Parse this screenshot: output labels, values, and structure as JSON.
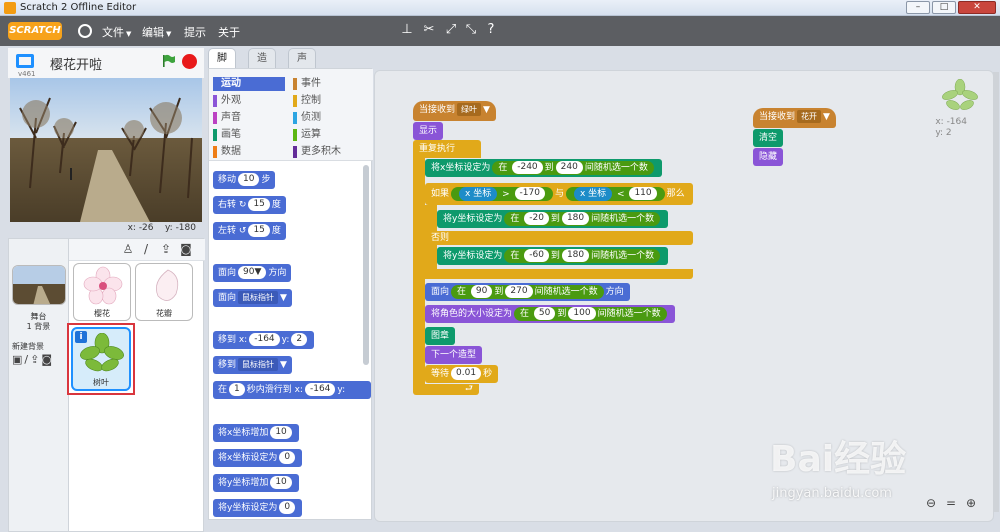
{
  "window": {
    "title": "Scratch 2 Offline Editor"
  },
  "menubar": {
    "logo": "SCRATCH",
    "menus": [
      {
        "label": "文件",
        "arrow": "▼"
      },
      {
        "label": "编辑",
        "arrow": "▼"
      },
      {
        "label": "提示",
        "arrow": ""
      },
      {
        "label": "关于",
        "arrow": ""
      }
    ],
    "tools": [
      "stamp-icon",
      "scissors-icon",
      "grow-icon",
      "shrink-icon",
      "help-icon"
    ]
  },
  "stage": {
    "project_title": "樱花开啦",
    "version": "v461",
    "mouse_x_label": "x:",
    "mouse_x": "-26",
    "mouse_y_label": "y:",
    "mouse_y": "-180"
  },
  "sprites": {
    "backdrop_label": "舞台",
    "backdrop_count": "1 背景",
    "new_backdrop_label": "新建背景",
    "items": [
      {
        "name": "樱花"
      },
      {
        "name": "花瓣"
      },
      {
        "name": "树叶"
      }
    ]
  },
  "tabs": [
    "脚本",
    "造型",
    "声音"
  ],
  "categories": {
    "left": [
      {
        "label": "运动",
        "color": "#4a6cd4",
        "active": true
      },
      {
        "label": "外观",
        "color": "#8a55d7"
      },
      {
        "label": "声音",
        "color": "#bb42c3"
      },
      {
        "label": "画笔",
        "color": "#0e9a6c"
      },
      {
        "label": "数据",
        "color": "#ee7d16"
      }
    ],
    "right": [
      {
        "label": "事件",
        "color": "#c88330"
      },
      {
        "label": "控制",
        "color": "#e1a91a"
      },
      {
        "label": "侦测",
        "color": "#2ca5e2"
      },
      {
        "label": "运算",
        "color": "#5cb712"
      },
      {
        "label": "更多积木",
        "color": "#632d99"
      }
    ]
  },
  "palette": {
    "move": {
      "pre": "移动",
      "val": "10",
      "post": "步"
    },
    "turn_right": {
      "pre": "右转",
      "val": "15",
      "post": "度"
    },
    "turn_left": {
      "pre": "左转",
      "val": "15",
      "post": "度"
    },
    "point_dir": {
      "pre": "面向",
      "val": "90▼",
      "post": "方向"
    },
    "point_towards": {
      "pre": "面向",
      "dd": "鼠标指针"
    },
    "goto_xy": {
      "pre": "移到 x:",
      "x": "-164",
      "mid": "y:",
      "y": "2"
    },
    "goto": {
      "pre": "移到",
      "dd": "鼠标指针"
    },
    "glide": {
      "pre": "在",
      "val": "1",
      "mid": "秒内滑行到 x:",
      "x": "-164",
      "post": "y:"
    },
    "change_x": {
      "pre": "将x坐标增加",
      "val": "10"
    },
    "set_x": {
      "pre": "将x坐标设定为",
      "val": "0"
    },
    "change_y": {
      "pre": "将y坐标增加",
      "val": "10"
    },
    "set_y": {
      "pre": "将y坐标设定为",
      "val": "0"
    }
  },
  "script1": {
    "hat": {
      "pre": "当接收到",
      "dd": "绿叶"
    },
    "show": "显示",
    "forever": "重复执行",
    "setx": {
      "pre": "将x坐标设定为",
      "in": "在",
      "a": "-240",
      "to": "到",
      "b": "240",
      "post": "间随机选一个数"
    },
    "if": {
      "pre": "如果",
      "xpos": "x 坐标",
      "gt": ">",
      "v1": "-170",
      "and": "与",
      "xpos2": "x 坐标",
      "lt": "<",
      "v2": "110",
      "post": "那么"
    },
    "sety1": {
      "pre": "将y坐标设定为",
      "in": "在",
      "a": "-20",
      "to": "到",
      "b": "180",
      "post": "间随机选一个数"
    },
    "else": "否则",
    "sety2": {
      "pre": "将y坐标设定为",
      "in": "在",
      "a": "-60",
      "to": "到",
      "b": "180",
      "post": "间随机选一个数"
    },
    "point": {
      "pre": "面向",
      "in": "在",
      "a": "90",
      "to": "到",
      "b": "270",
      "post": "间随机选一个数",
      "tail": "方向"
    },
    "size": {
      "pre": "将角色的大小设定为",
      "in": "在",
      "a": "50",
      "to": "到",
      "b": "100",
      "post": "间随机选一个数"
    },
    "stamp": "图章",
    "next_costume": "下一个造型",
    "wait": {
      "pre": "等待",
      "val": "0.01",
      "post": "秒"
    },
    "loop_arrow": "⮐"
  },
  "script2": {
    "hat": {
      "pre": "当接收到",
      "dd": "花开"
    },
    "clear": "清空",
    "hide": "隐藏"
  },
  "corner": {
    "x": "x: -164",
    "y": "y: 2"
  },
  "watermark": {
    "logo": "Bai经验",
    "url": "jingyan.baidu.com"
  }
}
